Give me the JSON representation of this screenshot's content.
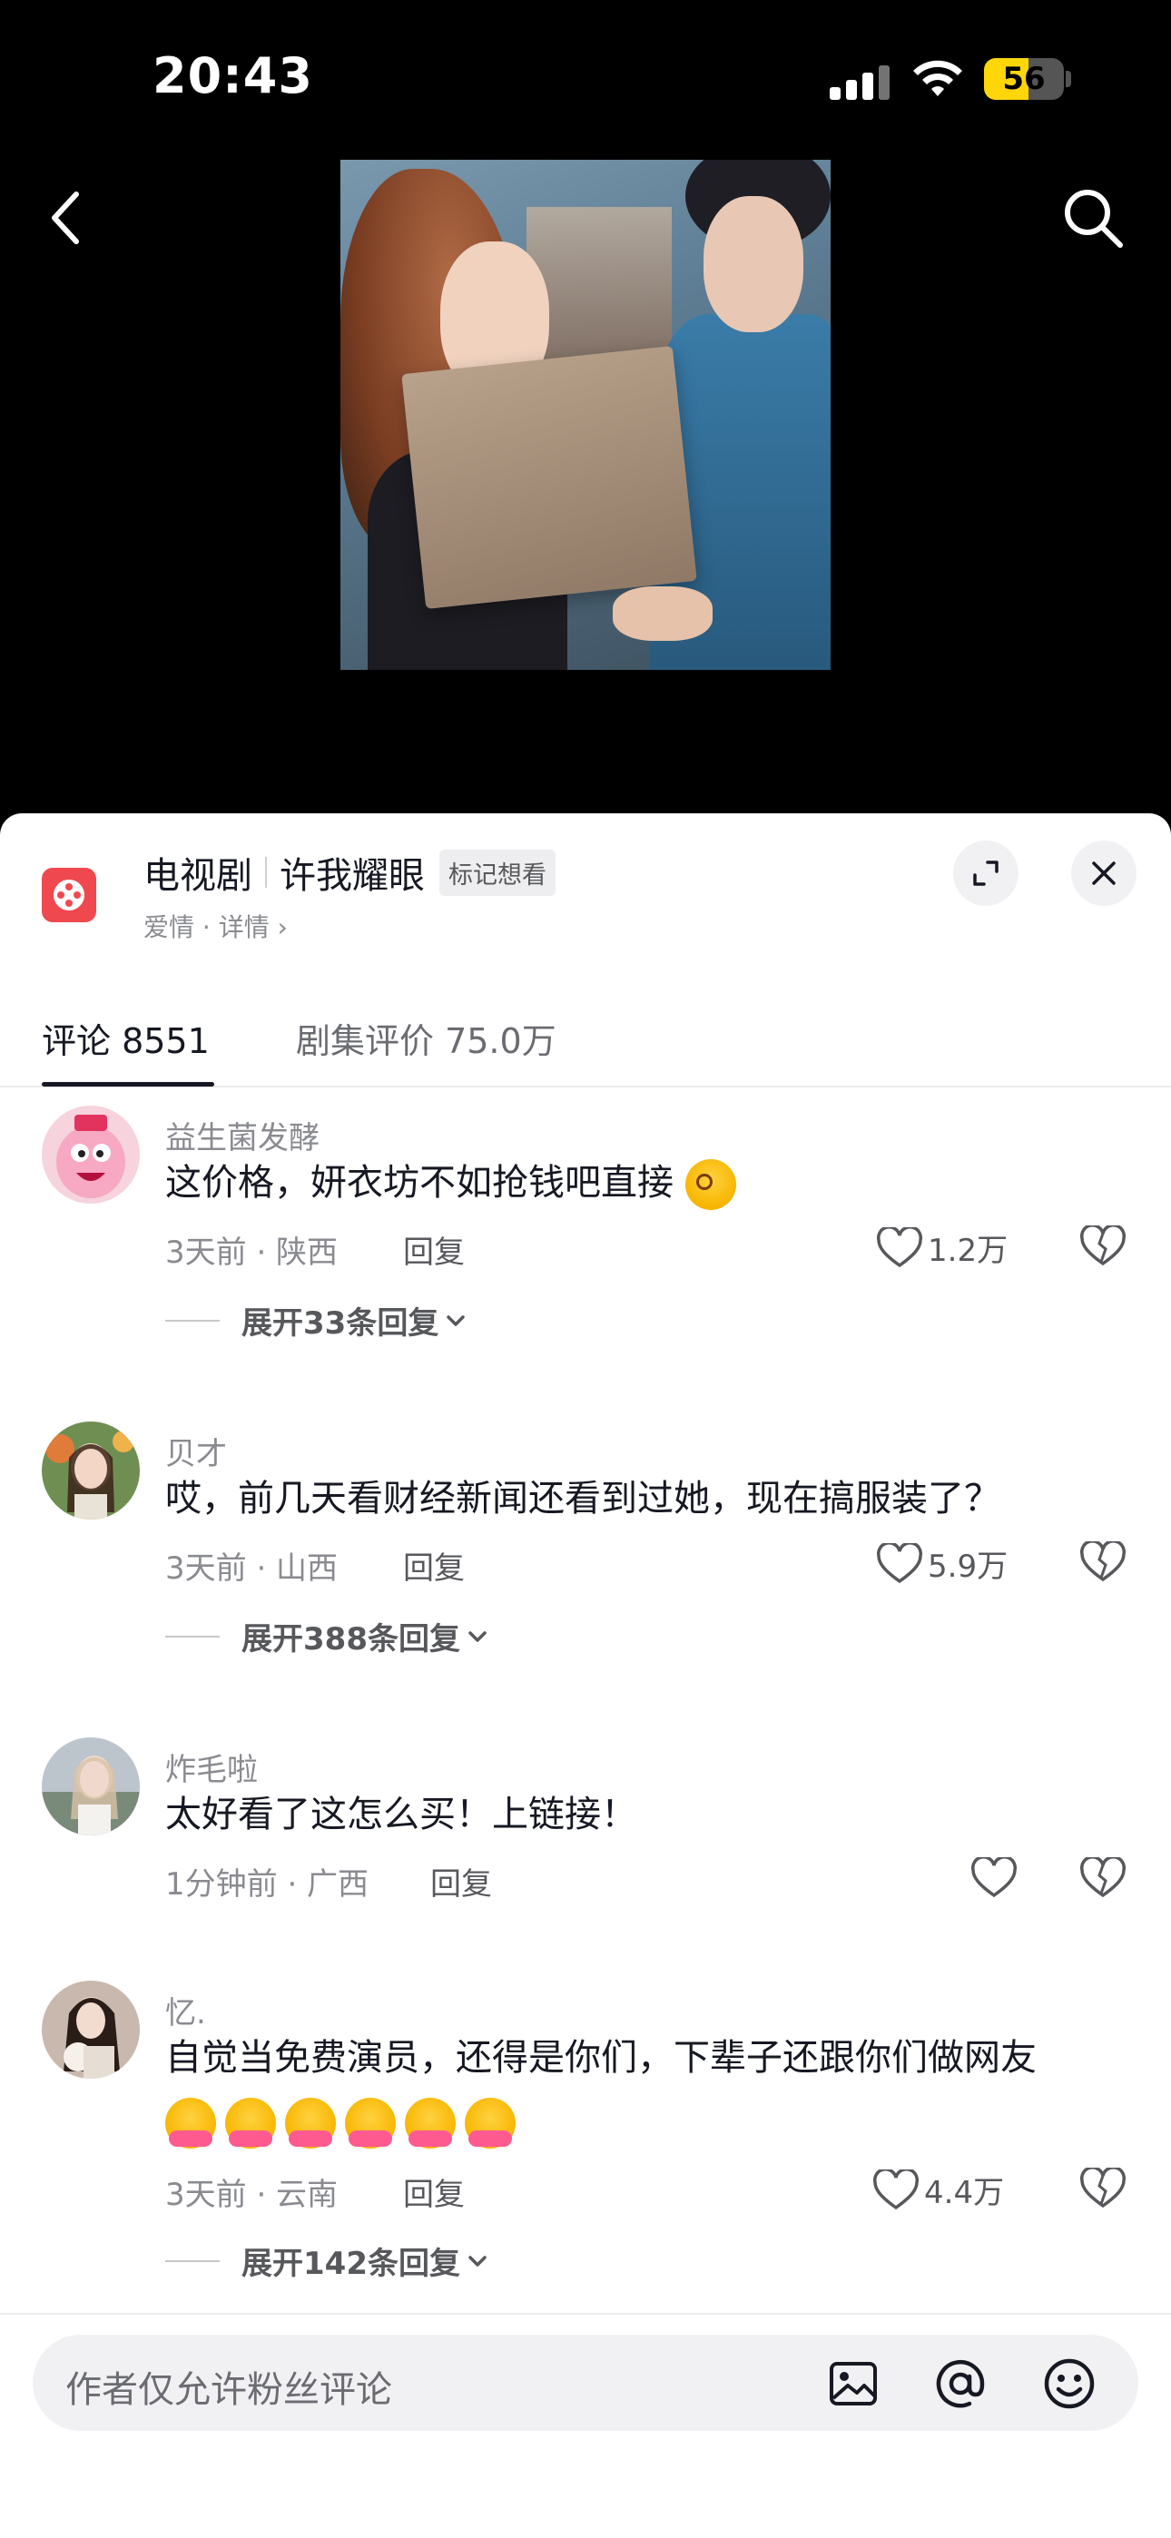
{
  "status_bar": {
    "time": "20:43",
    "battery": "56",
    "battery_level": 0.56
  },
  "drama": {
    "type": "电视剧",
    "name": "许我耀眼",
    "want_badge": "标记想看",
    "subtitle": "爱情 · 详情 ›"
  },
  "tabs": [
    {
      "label": "评论 8551",
      "active": true
    },
    {
      "label": "剧集评价 75.0万",
      "active": false
    }
  ],
  "comments": [
    {
      "name": "益生菌发酵",
      "text": "这价格，妍衣坊不如抢钱吧直接",
      "emoji": [
        "dizzy"
      ],
      "meta": "3天前 · 陕西",
      "reply": "回复",
      "likes": "1.2万",
      "expand": "展开33条回复"
    },
    {
      "name": "贝才",
      "text": "哎，前几天看财经新闻还看到过她，现在搞服装了？",
      "meta": "3天前 · 山西",
      "reply": "回复",
      "likes": "5.9万",
      "expand": "展开388条回复"
    },
    {
      "name": "炸毛啦",
      "text": "太好看了这怎么买！上链接！",
      "meta": "1分钟前 · 广西",
      "reply": "回复",
      "likes": ""
    },
    {
      "name": "忆.",
      "text": "自觉当免费演员，还得是你们，下辈子还跟你们做网友",
      "emoji": [
        "hug",
        "hug",
        "hug",
        "hug",
        "hug",
        "hug"
      ],
      "meta": "3天前 · 云南",
      "reply": "回复",
      "likes": "4.4万",
      "expand": "展开142条回复"
    }
  ],
  "input": {
    "placeholder": "作者仅允许粉丝评论"
  },
  "icons": {
    "back": "back-arrow-icon",
    "search": "search-icon",
    "expand": "expand-icon",
    "close": "close-icon",
    "like": "heart-icon",
    "dislike": "broken-heart-icon",
    "image": "image-icon",
    "mention": "at-icon",
    "emoji": "emoji-icon"
  },
  "colors": {
    "accent": "#f0484f",
    "battery": "#ffd60a",
    "text": "#161823",
    "muted": "#8a8b91"
  }
}
